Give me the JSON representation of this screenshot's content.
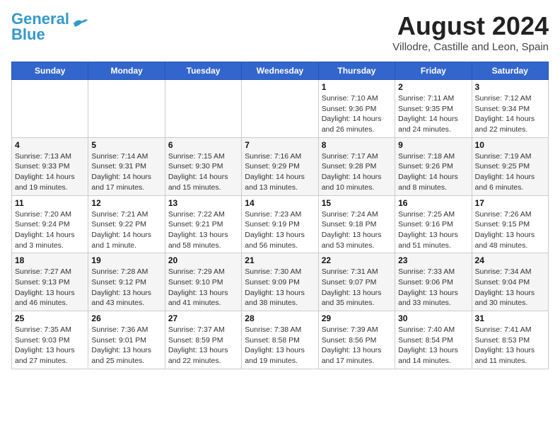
{
  "logo": {
    "line1": "General",
    "line2": "Blue"
  },
  "title": "August 2024",
  "subtitle": "Villodre, Castille and Leon, Spain",
  "days_header": [
    "Sunday",
    "Monday",
    "Tuesday",
    "Wednesday",
    "Thursday",
    "Friday",
    "Saturday"
  ],
  "weeks": [
    [
      {
        "day": "",
        "info": ""
      },
      {
        "day": "",
        "info": ""
      },
      {
        "day": "",
        "info": ""
      },
      {
        "day": "",
        "info": ""
      },
      {
        "day": "1",
        "info": "Sunrise: 7:10 AM\nSunset: 9:36 PM\nDaylight: 14 hours and 26 minutes."
      },
      {
        "day": "2",
        "info": "Sunrise: 7:11 AM\nSunset: 9:35 PM\nDaylight: 14 hours and 24 minutes."
      },
      {
        "day": "3",
        "info": "Sunrise: 7:12 AM\nSunset: 9:34 PM\nDaylight: 14 hours and 22 minutes."
      }
    ],
    [
      {
        "day": "4",
        "info": "Sunrise: 7:13 AM\nSunset: 9:33 PM\nDaylight: 14 hours and 19 minutes."
      },
      {
        "day": "5",
        "info": "Sunrise: 7:14 AM\nSunset: 9:31 PM\nDaylight: 14 hours and 17 minutes."
      },
      {
        "day": "6",
        "info": "Sunrise: 7:15 AM\nSunset: 9:30 PM\nDaylight: 14 hours and 15 minutes."
      },
      {
        "day": "7",
        "info": "Sunrise: 7:16 AM\nSunset: 9:29 PM\nDaylight: 14 hours and 13 minutes."
      },
      {
        "day": "8",
        "info": "Sunrise: 7:17 AM\nSunset: 9:28 PM\nDaylight: 14 hours and 10 minutes."
      },
      {
        "day": "9",
        "info": "Sunrise: 7:18 AM\nSunset: 9:26 PM\nDaylight: 14 hours and 8 minutes."
      },
      {
        "day": "10",
        "info": "Sunrise: 7:19 AM\nSunset: 9:25 PM\nDaylight: 14 hours and 6 minutes."
      }
    ],
    [
      {
        "day": "11",
        "info": "Sunrise: 7:20 AM\nSunset: 9:24 PM\nDaylight: 14 hours and 3 minutes."
      },
      {
        "day": "12",
        "info": "Sunrise: 7:21 AM\nSunset: 9:22 PM\nDaylight: 14 hours and 1 minute."
      },
      {
        "day": "13",
        "info": "Sunrise: 7:22 AM\nSunset: 9:21 PM\nDaylight: 13 hours and 58 minutes."
      },
      {
        "day": "14",
        "info": "Sunrise: 7:23 AM\nSunset: 9:19 PM\nDaylight: 13 hours and 56 minutes."
      },
      {
        "day": "15",
        "info": "Sunrise: 7:24 AM\nSunset: 9:18 PM\nDaylight: 13 hours and 53 minutes."
      },
      {
        "day": "16",
        "info": "Sunrise: 7:25 AM\nSunset: 9:16 PM\nDaylight: 13 hours and 51 minutes."
      },
      {
        "day": "17",
        "info": "Sunrise: 7:26 AM\nSunset: 9:15 PM\nDaylight: 13 hours and 48 minutes."
      }
    ],
    [
      {
        "day": "18",
        "info": "Sunrise: 7:27 AM\nSunset: 9:13 PM\nDaylight: 13 hours and 46 minutes."
      },
      {
        "day": "19",
        "info": "Sunrise: 7:28 AM\nSunset: 9:12 PM\nDaylight: 13 hours and 43 minutes."
      },
      {
        "day": "20",
        "info": "Sunrise: 7:29 AM\nSunset: 9:10 PM\nDaylight: 13 hours and 41 minutes."
      },
      {
        "day": "21",
        "info": "Sunrise: 7:30 AM\nSunset: 9:09 PM\nDaylight: 13 hours and 38 minutes."
      },
      {
        "day": "22",
        "info": "Sunrise: 7:31 AM\nSunset: 9:07 PM\nDaylight: 13 hours and 35 minutes."
      },
      {
        "day": "23",
        "info": "Sunrise: 7:33 AM\nSunset: 9:06 PM\nDaylight: 13 hours and 33 minutes."
      },
      {
        "day": "24",
        "info": "Sunrise: 7:34 AM\nSunset: 9:04 PM\nDaylight: 13 hours and 30 minutes."
      }
    ],
    [
      {
        "day": "25",
        "info": "Sunrise: 7:35 AM\nSunset: 9:03 PM\nDaylight: 13 hours and 27 minutes."
      },
      {
        "day": "26",
        "info": "Sunrise: 7:36 AM\nSunset: 9:01 PM\nDaylight: 13 hours and 25 minutes."
      },
      {
        "day": "27",
        "info": "Sunrise: 7:37 AM\nSunset: 8:59 PM\nDaylight: 13 hours and 22 minutes."
      },
      {
        "day": "28",
        "info": "Sunrise: 7:38 AM\nSunset: 8:58 PM\nDaylight: 13 hours and 19 minutes."
      },
      {
        "day": "29",
        "info": "Sunrise: 7:39 AM\nSunset: 8:56 PM\nDaylight: 13 hours and 17 minutes."
      },
      {
        "day": "30",
        "info": "Sunrise: 7:40 AM\nSunset: 8:54 PM\nDaylight: 13 hours and 14 minutes."
      },
      {
        "day": "31",
        "info": "Sunrise: 7:41 AM\nSunset: 8:53 PM\nDaylight: 13 hours and 11 minutes."
      }
    ]
  ]
}
